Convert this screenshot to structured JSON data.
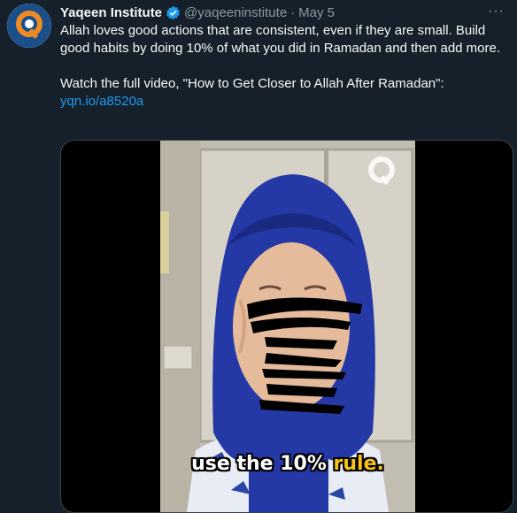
{
  "author": {
    "name": "Yaqeen Institute",
    "handle": "@yaqeeninstitute",
    "separator": "·",
    "date": "May 5"
  },
  "tweet": {
    "line1": "Allah loves good actions that are consistent, even if they are small. Build good habits by doing 10% of what you did in Ramadan and then add more.",
    "line2": "Watch the full video, \"How to Get Closer to Allah After Ramadan\":",
    "link": "yqn.io/a8520a"
  },
  "video": {
    "caption_prefix": "use the 10% ",
    "caption_accent": "rule."
  },
  "icons": {
    "avatar": "yaqeen-logo-icon",
    "verified": "verified-badge-icon",
    "more": "more-options-icon",
    "watermark": "yaqeen-watermark-icon"
  },
  "colors": {
    "background": "#15202b",
    "link": "#1d9bf0",
    "brand_orange": "#f08a24",
    "brand_blue": "#1b4f8a",
    "caption_accent": "#f6c21b"
  }
}
